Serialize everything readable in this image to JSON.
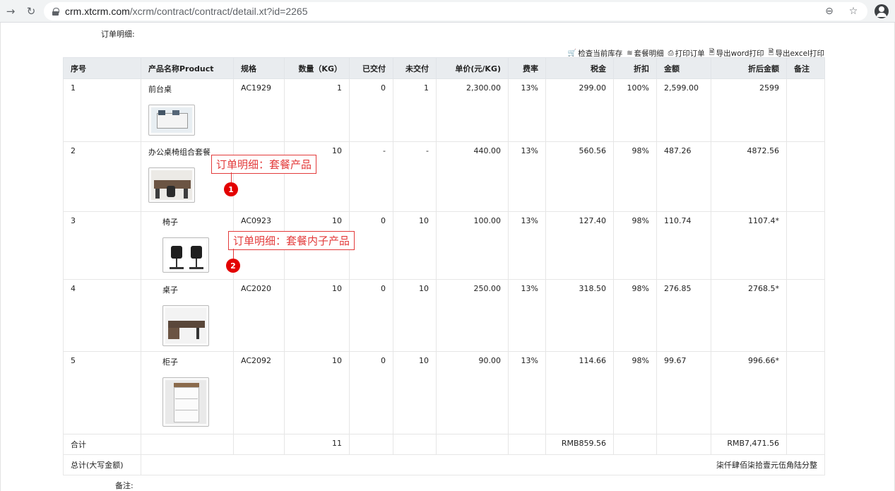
{
  "browser": {
    "back_icon": "arrow-left-icon",
    "reload_icon": "reload-icon",
    "url_host": "crm.xtcrm.com",
    "url_path": "/xcrm/contract/contract/detail.xt?id=2265",
    "zoom_icon": "zoom-icon",
    "star_icon": "star-icon",
    "profile_icon": "profile-icon"
  },
  "section_title": "订单明细:",
  "toolbar": [
    {
      "icon": "cart-icon",
      "glyph": "🛒",
      "label": "检查当前库存"
    },
    {
      "icon": "layers-icon",
      "glyph": "≋",
      "label": "套餐明细"
    },
    {
      "icon": "printer-icon",
      "glyph": "⎙",
      "label": "打印订单"
    },
    {
      "icon": "word-file-icon",
      "glyph": "🗎",
      "label": "导出word打印"
    },
    {
      "icon": "excel-file-icon",
      "glyph": "🗎",
      "label": "导出excel打印"
    }
  ],
  "columns": [
    "序号",
    "产品名称Product",
    "规格",
    "数量（KG）",
    "已交付",
    "未交付",
    "单价(元/KG)",
    "费率",
    "税金",
    "折扣",
    "金额",
    "折后金额",
    "备注"
  ],
  "rows": [
    {
      "no": "1",
      "name": "前台桌",
      "spec": "AC1929",
      "qty": "1",
      "delivered": "0",
      "undelivered": "1",
      "price": "2,300.00",
      "rate": "13%",
      "tax": "299.00",
      "discount": "100%",
      "amount": "2,599.00",
      "discounted": "2599",
      "remark": ""
    },
    {
      "no": "2",
      "name": "办公桌椅组合套餐",
      "spec": "",
      "qty": "10",
      "delivered": "-",
      "undelivered": "-",
      "price": "440.00",
      "rate": "13%",
      "tax": "560.56",
      "discount": "98%",
      "amount": "487.26",
      "discounted": "4872.56",
      "remark": ""
    },
    {
      "no": "3",
      "name": "椅子",
      "spec": "AC0923",
      "qty": "10",
      "delivered": "0",
      "undelivered": "10",
      "price": "100.00",
      "rate": "13%",
      "tax": "127.40",
      "discount": "98%",
      "amount": "110.74",
      "discounted": "1107.4*",
      "remark": ""
    },
    {
      "no": "4",
      "name": "桌子",
      "spec": "AC2020",
      "qty": "10",
      "delivered": "0",
      "undelivered": "10",
      "price": "250.00",
      "rate": "13%",
      "tax": "318.50",
      "discount": "98%",
      "amount": "276.85",
      "discounted": "2768.5*",
      "remark": ""
    },
    {
      "no": "5",
      "name": "柜子",
      "spec": "AC2092",
      "qty": "10",
      "delivered": "0",
      "undelivered": "10",
      "price": "90.00",
      "rate": "13%",
      "tax": "114.66",
      "discount": "98%",
      "amount": "99.67",
      "discounted": "996.66*",
      "remark": ""
    }
  ],
  "totals": {
    "label": "合计",
    "qty": "11",
    "tax": "RMB859.56",
    "discounted": "RMB7,471.56"
  },
  "grand_total": {
    "label": "总计(大写金额)",
    "value": "柒仟肆佰柒拾壹元伍角陆分整"
  },
  "remark_label": "备注:",
  "annotations": [
    {
      "text": "订单明细：套餐产品",
      "number": "1"
    },
    {
      "text": "订单明细：套餐内子产品",
      "number": "2"
    }
  ],
  "colors": {
    "annotation_red": "#e33b3b",
    "header_bg": "#e9ecef"
  }
}
